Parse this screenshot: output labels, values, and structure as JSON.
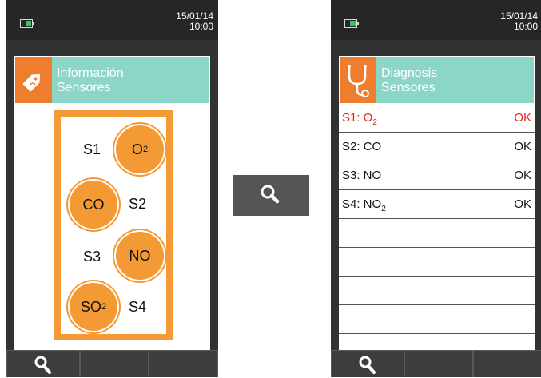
{
  "left_device": {
    "date": "15/01/14",
    "time": "10:00",
    "header": {
      "line1": "Información",
      "line2": "Sensores",
      "icon": "tag-icon"
    },
    "sensors": [
      {
        "id": "S1",
        "gas": "O",
        "sub": "2"
      },
      {
        "id": "S2",
        "gas": "CO",
        "sub": ""
      },
      {
        "id": "S3",
        "gas": "NO",
        "sub": ""
      },
      {
        "id": "S4",
        "gas": "SO",
        "sub": "2"
      }
    ],
    "softkey_icon": "search-icon"
  },
  "middle_button": {
    "icon": "search-icon"
  },
  "right_device": {
    "date": "15/01/14",
    "time": "10:00",
    "header": {
      "line1": "Diagnosis",
      "line2": "Sensores",
      "icon": "stethoscope-icon"
    },
    "rows": [
      {
        "name": "S1: O",
        "sub": "2",
        "status": "OK",
        "active": true
      },
      {
        "name": "S2: CO",
        "sub": "",
        "status": "OK",
        "active": false
      },
      {
        "name": "S3: NO",
        "sub": "",
        "status": "OK",
        "active": false
      },
      {
        "name": "S4: NO",
        "sub": "2",
        "status": "OK",
        "active": false
      }
    ],
    "softkey_icon": "search-icon"
  },
  "colors": {
    "orange": "#f39a35",
    "header_teal": "#8cd6c8",
    "alert_red": "#e0241c",
    "device_body": "#323232"
  }
}
